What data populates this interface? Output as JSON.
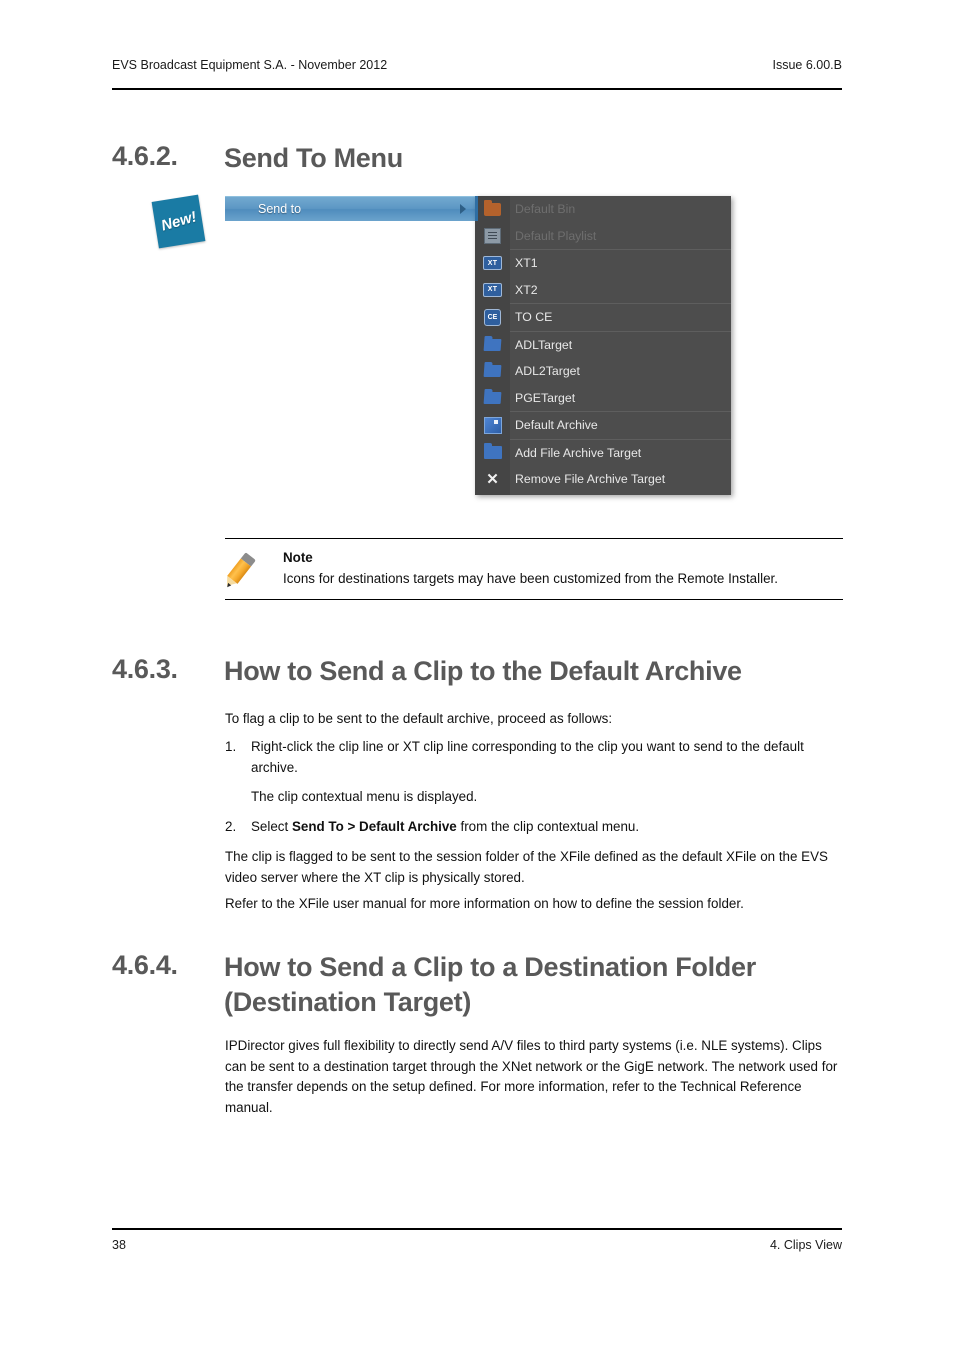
{
  "header": {
    "left": "EVS Broadcast Equipment S.A.  - November 2012",
    "right": "Issue 6.00.B"
  },
  "sections": {
    "s462": {
      "number": "4.6.2.",
      "title": "Send To Menu"
    },
    "s463": {
      "number": "4.6.3.",
      "title": "How to Send a Clip to the Default Archive"
    },
    "s464": {
      "number": "4.6.4.",
      "title": "How to Send a Clip to a Destination Folder (Destination Target)"
    }
  },
  "figure": {
    "badge": "New!",
    "parent_menu_item": "Send to",
    "submenu_items": [
      {
        "label": "Default Bin",
        "icon": "folder-orange-icon",
        "disabled": true
      },
      {
        "label": "Default Playlist",
        "icon": "playlist-icon",
        "disabled": true
      },
      {
        "label": "XT1",
        "icon": "xt-icon",
        "icon_text": "XT",
        "disabled": false
      },
      {
        "label": "XT2",
        "icon": "xt-icon",
        "icon_text": "XT",
        "disabled": false
      },
      {
        "label": "TO CE",
        "icon": "ce-icon",
        "icon_text": "CE",
        "disabled": false
      },
      {
        "label": "ADLTarget",
        "icon": "folder-open-blue-icon",
        "disabled": false
      },
      {
        "label": "ADL2Target",
        "icon": "folder-open-blue-icon",
        "disabled": false
      },
      {
        "label": "PGETarget",
        "icon": "folder-open-blue-icon",
        "disabled": false
      },
      {
        "label": "Default Archive",
        "icon": "archive-box-icon",
        "disabled": false
      },
      {
        "label": "Add File Archive Target",
        "icon": "folder-closed-blue-icon",
        "disabled": false
      },
      {
        "label": "Remove File Archive Target",
        "icon": "close-x-icon",
        "icon_text": "✕",
        "disabled": false
      }
    ],
    "colors": {
      "menu_background": "#4d4d4d",
      "icon_gutter": "#454545",
      "highlight_blue": "#5c97c4",
      "badge_teal": "#1a7ba4",
      "disabled_text": "#6e6e6e",
      "enabled_text": "#e8e8e8"
    }
  },
  "note": {
    "title": "Note",
    "text": "Icons for destinations targets may have been customized from the Remote Installer."
  },
  "s463_body": {
    "intro": "To flag a clip to be sent to the default archive, proceed as follows:",
    "steps": [
      {
        "n": "1.",
        "text": "Right-click the clip line or XT clip line corresponding to the clip you want to send to the default archive."
      },
      {
        "n": "2.",
        "text_before": "Select ",
        "bold": "Send To > Default Archive",
        "text_after": " from the clip contextual menu."
      }
    ],
    "step1_result": "The clip contextual menu is displayed.",
    "para1": "The clip is flagged to be sent to the session folder of the XFile defined as the default XFile on the EVS video server where the XT clip is physically stored.",
    "para2": "Refer to the XFile user manual for more information on how to define the session folder."
  },
  "s464_body": {
    "para1": "IPDirector gives full flexibility to directly send A/V files to third party systems (i.e. NLE systems). Clips can be sent to a destination target through the XNet network or the GigE network. The network used for the transfer depends on the setup defined. For more information, refer to the Technical Reference manual."
  },
  "footer": {
    "page_number": "38",
    "chapter": "4. Clips View"
  }
}
